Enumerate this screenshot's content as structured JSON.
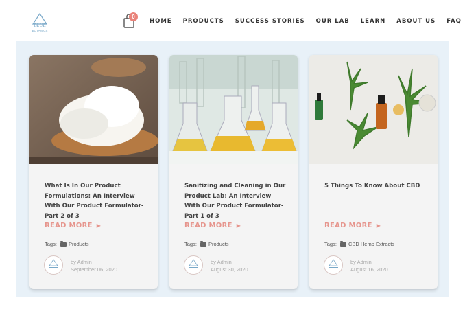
{
  "brand": {
    "logo_top": "BLUE",
    "logo_bottom": "BOTANICS"
  },
  "cart": {
    "count": "0"
  },
  "nav": [
    "HOME",
    "PRODUCTS",
    "SUCCESS STORIES",
    "OUR LAB",
    "LEARN",
    "ABOUT US",
    "FAQ"
  ],
  "posts": [
    {
      "title": "What Is In Our Product Formulations: An Interview With Our Product Formulator-Part 2 of 3",
      "read_more": "READ MORE",
      "tags_label": "Tags:",
      "tag": "Products",
      "author": "by Admin",
      "date": "September 06, 2020"
    },
    {
      "title": "Sanitizing and Cleaning in Our Product Lab: An Interview With Our Product Formulator-Part 1 of 3",
      "read_more": "READ MORE",
      "tags_label": "Tags:",
      "tag": "Products",
      "author": "by Admin",
      "date": "August 30, 2020"
    },
    {
      "title": "5 Things To Know About CBD",
      "read_more": "READ MORE",
      "tags_label": "Tags:",
      "tag": "CBD Hemp Extracts",
      "author": "by Admin",
      "date": "August 16, 2020"
    }
  ],
  "colors": {
    "accent": "#e6958d",
    "band": "#e8f1f8",
    "brand_blue": "#7aa9c9"
  }
}
